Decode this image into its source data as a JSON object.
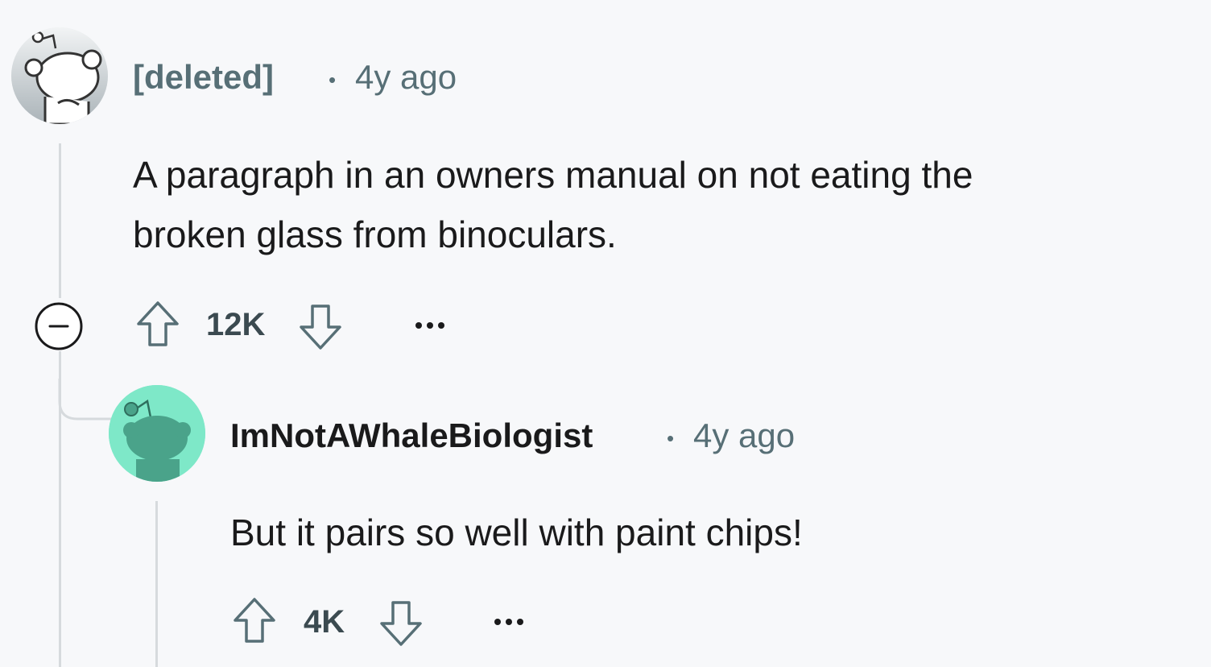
{
  "comments": [
    {
      "author": "[deleted]",
      "separator": "•",
      "time": "4y ago",
      "body_lines": [
        "A paragraph in an owners manual on not eating the",
        "broken glass from binoculars."
      ],
      "score": "12K",
      "avatar_color": "#e4e7ea"
    },
    {
      "author": "ImNotAWhaleBiologist",
      "separator": "•",
      "time": "4y ago",
      "body_lines": [
        "But it pairs so well with paint chips!"
      ],
      "score": "4K",
      "avatar_color": "#7ee8c8"
    }
  ],
  "icons": {
    "upvote": "upvote-icon",
    "downvote": "downvote-icon",
    "more": "more-options-icon",
    "collapse": "collapse-thread-icon"
  },
  "colors": {
    "background": "#f7f8fa",
    "meta_text": "#576f76",
    "thread_line": "#d6dadd"
  }
}
